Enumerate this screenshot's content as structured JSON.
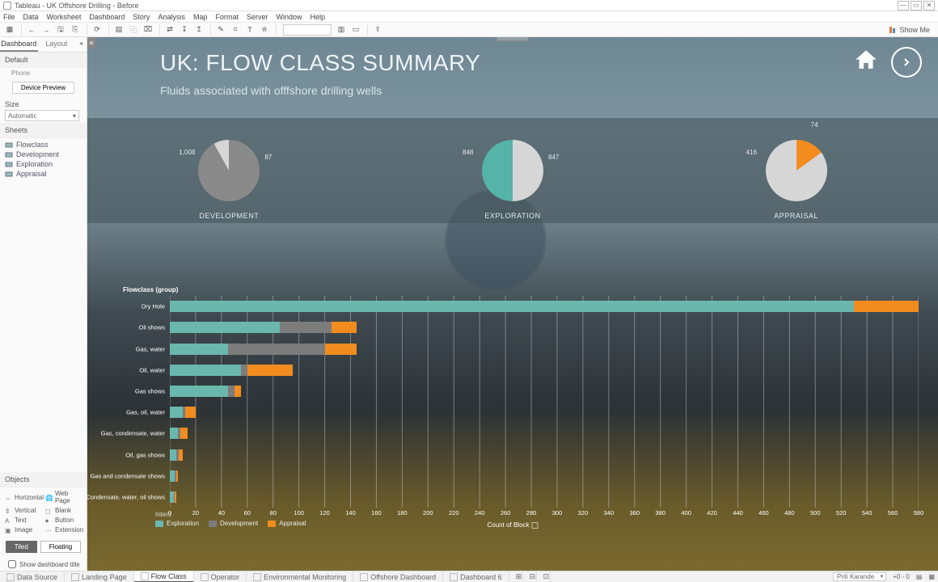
{
  "window": {
    "title": "Tableau - UK Offshore Drilling - Before",
    "min": "—",
    "max": "▭",
    "close": "✕"
  },
  "menu": [
    "File",
    "Data",
    "Worksheet",
    "Dashboard",
    "Story",
    "Analysis",
    "Map",
    "Format",
    "Server",
    "Window",
    "Help"
  ],
  "toolbar": {
    "showme": "Show Me"
  },
  "side": {
    "tabs": {
      "dashboard": "Dashboard",
      "layout": "Layout"
    },
    "device": {
      "label": "Default",
      "sub": "Phone",
      "preview": "Device Preview"
    },
    "size": {
      "title": "Size",
      "value": "Automatic"
    },
    "sheets": {
      "title": "Sheets",
      "items": [
        "Flowclass",
        "Development",
        "Exploration",
        "Appraisal"
      ]
    },
    "objects": {
      "title": "Objects",
      "left": [
        "Horizontal",
        "Vertical",
        "Text",
        "Image"
      ],
      "right": [
        "Web Page",
        "Blank",
        "Button",
        "Extension"
      ]
    },
    "tiled": "Tiled",
    "floating": "Floating",
    "showtitle": "Show dashboard title"
  },
  "dash": {
    "title": "UK: FLOW CLASS SUMMARY",
    "subtitle": "Fluids associated with offfshore drilling wells",
    "pies": [
      {
        "name": "DEVELOPMENT",
        "left_val": "1,008",
        "right_val": "87",
        "left_color": "#8a8a8a",
        "right_color": "#d6d6d6",
        "left_frac": 0.92
      },
      {
        "name": "EXPLORATION",
        "left_val": "848",
        "right_val": "847",
        "left_color": "#d6d6d6",
        "right_color": "#55b3a8",
        "left_frac": 0.5
      },
      {
        "name": "APPRAISAL",
        "left_val": "416",
        "right_val": "74",
        "left_color": "#d6d6d6",
        "right_color": "#f28c1f",
        "left_frac": 0.85,
        "top_label": true
      }
    ],
    "bars": {
      "header": "Flowclass (group)",
      "xaxis": "Count of Block",
      "xmax": 580,
      "legend": {
        "title": "Intent",
        "items": [
          {
            "name": "Exploration",
            "color": "#6ab7ad"
          },
          {
            "name": "Development",
            "color": "#7c7c7c"
          },
          {
            "name": "Appraisal",
            "color": "#f28c1f"
          }
        ]
      },
      "rows": [
        {
          "label": "Dry Hole",
          "exp": 530,
          "dev": 0,
          "app": 50
        },
        {
          "label": "Oil shows",
          "exp": 85,
          "dev": 40,
          "app": 20
        },
        {
          "label": "Gas, water",
          "exp": 45,
          "dev": 75,
          "app": 25
        },
        {
          "label": "Oil, water",
          "exp": 55,
          "dev": 5,
          "app": 35
        },
        {
          "label": "Gas shows",
          "exp": 45,
          "dev": 5,
          "app": 5
        },
        {
          "label": "Gas, oil, water",
          "exp": 10,
          "dev": 2,
          "app": 8
        },
        {
          "label": "Gas, condensate, water",
          "exp": 6,
          "dev": 2,
          "app": 6
        },
        {
          "label": "Oil, gas shows",
          "exp": 5,
          "dev": 2,
          "app": 3
        },
        {
          "label": "Gas and condensate shows",
          "exp": 4,
          "dev": 1,
          "app": 1
        },
        {
          "label": "Condensate, water, oil shows",
          "exp": 3,
          "dev": 1,
          "app": 1
        }
      ]
    }
  },
  "bottom_tabs": [
    {
      "label": "Data Source",
      "kind": "ds"
    },
    {
      "label": "Landing Page",
      "kind": "dash"
    },
    {
      "label": "Flow Class",
      "kind": "dash",
      "active": true
    },
    {
      "label": "Operator",
      "kind": "dash"
    },
    {
      "label": "Environmental Monitoring",
      "kind": "dash"
    },
    {
      "label": "Offshore Dashboard",
      "kind": "dash"
    },
    {
      "label": "Dashboard 6",
      "kind": "dash"
    }
  ],
  "status": {
    "user": "Priti Karande",
    "marks": "+0 - 0"
  },
  "chart_data": {
    "pies": [
      {
        "title": "DEVELOPMENT",
        "type": "pie",
        "slices": [
          {
            "label": "1,008",
            "value": 1008
          },
          {
            "label": "87",
            "value": 87
          }
        ]
      },
      {
        "title": "EXPLORATION",
        "type": "pie",
        "slices": [
          {
            "label": "848",
            "value": 848
          },
          {
            "label": "847",
            "value": 847
          }
        ]
      },
      {
        "title": "APPRAISAL",
        "type": "pie",
        "slices": [
          {
            "label": "416",
            "value": 416
          },
          {
            "label": "74",
            "value": 74
          }
        ]
      }
    ],
    "bars": {
      "type": "bar",
      "orientation": "horizontal",
      "stacked": true,
      "xlabel": "Count of Block",
      "xlim": [
        0,
        580
      ],
      "ylabel": "Flowclass (group)",
      "categories": [
        "Dry Hole",
        "Oil shows",
        "Gas, water",
        "Oil, water",
        "Gas shows",
        "Gas, oil, water",
        "Gas, condensate, water",
        "Oil, gas shows",
        "Gas and condensate shows",
        "Condensate, water, oil shows"
      ],
      "series": [
        {
          "name": "Exploration",
          "values": [
            530,
            85,
            45,
            55,
            45,
            10,
            6,
            5,
            4,
            3
          ]
        },
        {
          "name": "Development",
          "values": [
            0,
            40,
            75,
            5,
            5,
            2,
            2,
            2,
            1,
            1
          ]
        },
        {
          "name": "Appraisal",
          "values": [
            50,
            20,
            25,
            35,
            5,
            8,
            6,
            3,
            1,
            1
          ]
        }
      ]
    }
  }
}
